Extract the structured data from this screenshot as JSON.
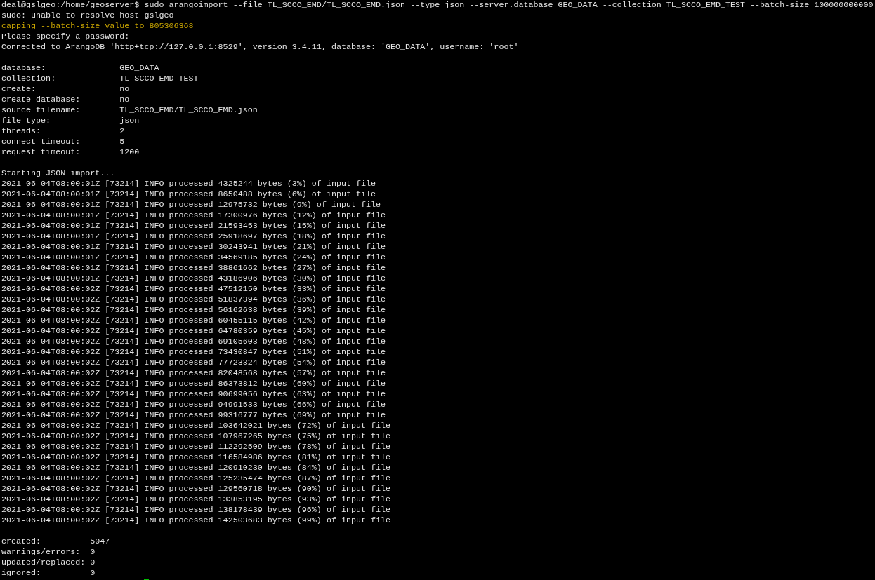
{
  "terminal": {
    "lines": [
      {
        "kind": "command",
        "text": "deal@gslgeo:/home/geoserver$ sudo arangoimport --file TL_SCCO_EMD/TL_SCCO_EMD.json --type json --server.database GEO_DATA --collection TL_SCCO_EMD_TEST --batch-size 100000000000"
      },
      {
        "kind": "output",
        "text": "sudo: unable to resolve host gslgeo"
      },
      {
        "kind": "warning",
        "text": "capping --batch-size value to 805306368"
      },
      {
        "kind": "output",
        "text": "Please specify a password:"
      },
      {
        "kind": "output",
        "text": "Connected to ArangoDB 'http+tcp://127.0.0.1:8529', version 3.4.11, database: 'GEO_DATA', username: 'root'"
      },
      {
        "kind": "output",
        "text": "----------------------------------------"
      },
      {
        "kind": "output",
        "text": "database:               GEO_DATA"
      },
      {
        "kind": "output",
        "text": "collection:             TL_SCCO_EMD_TEST"
      },
      {
        "kind": "output",
        "text": "create:                 no"
      },
      {
        "kind": "output",
        "text": "create database:        no"
      },
      {
        "kind": "output",
        "text": "source filename:        TL_SCCO_EMD/TL_SCCO_EMD.json"
      },
      {
        "kind": "output",
        "text": "file type:              json"
      },
      {
        "kind": "output",
        "text": "threads:                2"
      },
      {
        "kind": "output",
        "text": "connect timeout:        5"
      },
      {
        "kind": "output",
        "text": "request timeout:        1200"
      },
      {
        "kind": "output",
        "text": "----------------------------------------"
      },
      {
        "kind": "output",
        "text": "Starting JSON import..."
      },
      {
        "kind": "output",
        "text": "2021-06-04T08:00:01Z [73214] INFO processed 4325244 bytes (3%) of input file"
      },
      {
        "kind": "output",
        "text": "2021-06-04T08:00:01Z [73214] INFO processed 8650488 bytes (6%) of input file"
      },
      {
        "kind": "output",
        "text": "2021-06-04T08:00:01Z [73214] INFO processed 12975732 bytes (9%) of input file"
      },
      {
        "kind": "output",
        "text": "2021-06-04T08:00:01Z [73214] INFO processed 17300976 bytes (12%) of input file"
      },
      {
        "kind": "output",
        "text": "2021-06-04T08:00:01Z [73214] INFO processed 21593453 bytes (15%) of input file"
      },
      {
        "kind": "output",
        "text": "2021-06-04T08:00:01Z [73214] INFO processed 25918697 bytes (18%) of input file"
      },
      {
        "kind": "output",
        "text": "2021-06-04T08:00:01Z [73214] INFO processed 30243941 bytes (21%) of input file"
      },
      {
        "kind": "output",
        "text": "2021-06-04T08:00:01Z [73214] INFO processed 34569185 bytes (24%) of input file"
      },
      {
        "kind": "output",
        "text": "2021-06-04T08:00:01Z [73214] INFO processed 38861662 bytes (27%) of input file"
      },
      {
        "kind": "output",
        "text": "2021-06-04T08:00:01Z [73214] INFO processed 43186906 bytes (30%) of input file"
      },
      {
        "kind": "output",
        "text": "2021-06-04T08:00:02Z [73214] INFO processed 47512150 bytes (33%) of input file"
      },
      {
        "kind": "output",
        "text": "2021-06-04T08:00:02Z [73214] INFO processed 51837394 bytes (36%) of input file"
      },
      {
        "kind": "output",
        "text": "2021-06-04T08:00:02Z [73214] INFO processed 56162638 bytes (39%) of input file"
      },
      {
        "kind": "output",
        "text": "2021-06-04T08:00:02Z [73214] INFO processed 60455115 bytes (42%) of input file"
      },
      {
        "kind": "output",
        "text": "2021-06-04T08:00:02Z [73214] INFO processed 64780359 bytes (45%) of input file"
      },
      {
        "kind": "output",
        "text": "2021-06-04T08:00:02Z [73214] INFO processed 69105603 bytes (48%) of input file"
      },
      {
        "kind": "output",
        "text": "2021-06-04T08:00:02Z [73214] INFO processed 73430847 bytes (51%) of input file"
      },
      {
        "kind": "output",
        "text": "2021-06-04T08:00:02Z [73214] INFO processed 77723324 bytes (54%) of input file"
      },
      {
        "kind": "output",
        "text": "2021-06-04T08:00:02Z [73214] INFO processed 82048568 bytes (57%) of input file"
      },
      {
        "kind": "output",
        "text": "2021-06-04T08:00:02Z [73214] INFO processed 86373812 bytes (60%) of input file"
      },
      {
        "kind": "output",
        "text": "2021-06-04T08:00:02Z [73214] INFO processed 90699056 bytes (63%) of input file"
      },
      {
        "kind": "output",
        "text": "2021-06-04T08:00:02Z [73214] INFO processed 94991533 bytes (66%) of input file"
      },
      {
        "kind": "output",
        "text": "2021-06-04T08:00:02Z [73214] INFO processed 99316777 bytes (69%) of input file"
      },
      {
        "kind": "output",
        "text": "2021-06-04T08:00:02Z [73214] INFO processed 103642021 bytes (72%) of input file"
      },
      {
        "kind": "output",
        "text": "2021-06-04T08:00:02Z [73214] INFO processed 107967265 bytes (75%) of input file"
      },
      {
        "kind": "output",
        "text": "2021-06-04T08:00:02Z [73214] INFO processed 112292509 bytes (78%) of input file"
      },
      {
        "kind": "output",
        "text": "2021-06-04T08:00:02Z [73214] INFO processed 116584986 bytes (81%) of input file"
      },
      {
        "kind": "output",
        "text": "2021-06-04T08:00:02Z [73214] INFO processed 120910230 bytes (84%) of input file"
      },
      {
        "kind": "output",
        "text": "2021-06-04T08:00:02Z [73214] INFO processed 125235474 bytes (87%) of input file"
      },
      {
        "kind": "output",
        "text": "2021-06-04T08:00:02Z [73214] INFO processed 129560718 bytes (90%) of input file"
      },
      {
        "kind": "output",
        "text": "2021-06-04T08:00:02Z [73214] INFO processed 133853195 bytes (93%) of input file"
      },
      {
        "kind": "output",
        "text": "2021-06-04T08:00:02Z [73214] INFO processed 138178439 bytes (96%) of input file"
      },
      {
        "kind": "output",
        "text": "2021-06-04T08:00:02Z [73214] INFO processed 142503683 bytes (99%) of input file"
      },
      {
        "kind": "blank"
      },
      {
        "kind": "output",
        "text": "created:          5047"
      },
      {
        "kind": "output",
        "text": "warnings/errors:  0"
      },
      {
        "kind": "output",
        "text": "updated/replaced: 0"
      },
      {
        "kind": "output",
        "text": "ignored:          0"
      },
      {
        "kind": "cursor"
      }
    ]
  }
}
